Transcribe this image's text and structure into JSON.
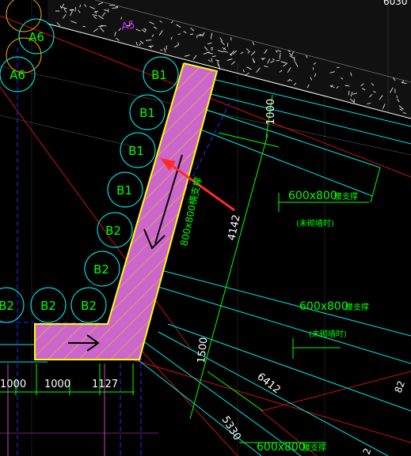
{
  "colors": {
    "background": "#000000",
    "pile_circle": "#00ffff",
    "pile_label": "#00ff00",
    "edge_circle": "#ffa500",
    "beam_fill": "#cc66cc",
    "beam_edge": "#ffff00",
    "beam_hatch": "#e8e000",
    "dimension": "#00ff00",
    "cyan_line": "#00e8e8",
    "red_line": "#cc1010",
    "blue_dash": "#2a2aff",
    "white_line": "#ffffff",
    "grey_line": "#aaaaaa",
    "marker_arrow": "#ff2a2a",
    "direction_arrow": "#000000"
  },
  "piles": [
    {
      "label": "A6"
    },
    {
      "label": "A6"
    },
    {
      "label": "B1"
    },
    {
      "label": "B1"
    },
    {
      "label": "B1"
    },
    {
      "label": "B1"
    },
    {
      "label": "B2"
    },
    {
      "label": "B2"
    },
    {
      "label": "B2"
    },
    {
      "label": "B2"
    },
    {
      "label": "B2"
    }
  ],
  "tag_top": "A5",
  "corner_number": "6030",
  "dims": {
    "d1000_top": "1000",
    "d4142": "4142",
    "d1500": "1500",
    "d6412": "6412",
    "d5330": "5330",
    "d1000_left": "1000",
    "d1000_mid": "1000",
    "d1127": "1127"
  },
  "beam_label": "800x800横支撑",
  "annotations": [
    {
      "size": "600x800",
      "suffix": "腰支撑",
      "note": "(未砌墙时)"
    },
    {
      "size": "600x800",
      "suffix": "腰支撑",
      "note": "(未砌墙时)"
    },
    {
      "size": "600x800",
      "suffix": "腰支撑"
    }
  ],
  "edge_marks": {
    "r1": "82",
    "r2": "2"
  }
}
